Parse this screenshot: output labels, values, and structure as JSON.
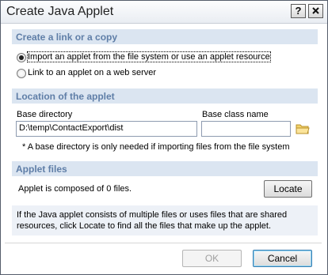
{
  "window": {
    "title": "Create Java Applet",
    "help_button": "?",
    "close_button": "X"
  },
  "link_section": {
    "heading": "Create a link or a copy",
    "options": [
      {
        "label": "Import an applet from the file system or use an applet resource",
        "selected": true
      },
      {
        "label": "Link to an applet on a web server",
        "selected": false
      }
    ]
  },
  "location_section": {
    "heading": "Location of the applet",
    "base_directory_label": "Base directory",
    "base_directory_value": "D:\\temp\\ContactExport\\dist",
    "base_class_label": "Base class name",
    "base_class_value": "",
    "note": "* A base directory is only needed if importing files from the file system",
    "browse_icon": "folder-icon"
  },
  "files_section": {
    "heading": "Applet files",
    "composed_text": "Applet is composed of 0 files.",
    "locate_label": "Locate",
    "info_text": "If the Java applet consists of multiple files or uses files that are shared resources, click Locate to find all the files that make up the applet."
  },
  "footer": {
    "ok_label": "OK",
    "cancel_label": "Cancel"
  },
  "colors": {
    "section_bg": "#dbe5f1",
    "section_text": "#5f7ea7",
    "info_bg": "#edf1f7"
  }
}
